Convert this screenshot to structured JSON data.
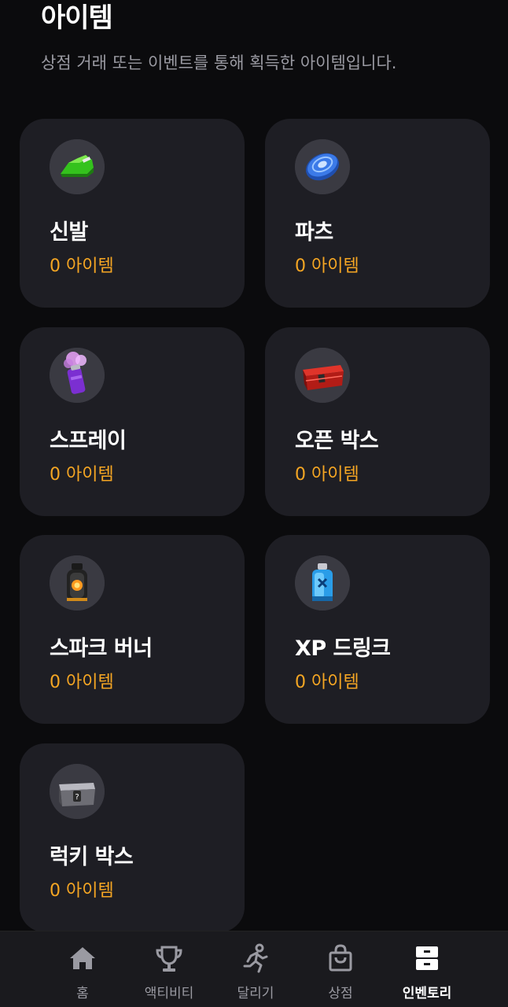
{
  "header": {
    "title": "아이템",
    "subtitle": "상점 거래 또는 이벤트를 통해 획득한 아이템입니다."
  },
  "items": [
    {
      "name": "신발",
      "count": "0 아이템",
      "icon": "sneaker-icon"
    },
    {
      "name": "파츠",
      "count": "0 아이템",
      "icon": "parts-disc-icon"
    },
    {
      "name": "스프레이",
      "count": "0 아이템",
      "icon": "spray-can-icon"
    },
    {
      "name": "오픈 박스",
      "count": "0 아이템",
      "icon": "red-box-icon"
    },
    {
      "name": "스파크 버너",
      "count": "0 아이템",
      "icon": "spark-burner-icon"
    },
    {
      "name": "XP 드링크",
      "count": "0 아이템",
      "icon": "xp-drink-icon"
    },
    {
      "name": "럭키 박스",
      "count": "0 아이템",
      "icon": "lucky-box-icon"
    }
  ],
  "tabbar": {
    "tabs": [
      {
        "label": "홈",
        "icon": "home-icon"
      },
      {
        "label": "액티비티",
        "icon": "trophy-icon"
      },
      {
        "label": "달리기",
        "icon": "runner-icon"
      },
      {
        "label": "상점",
        "icon": "shopping-bag-icon"
      },
      {
        "label": "인벤토리",
        "icon": "inventory-icon"
      }
    ],
    "active": "인벤토리"
  },
  "colors": {
    "background": "#0b0b0d",
    "card": "#1e1e24",
    "accent": "#f5a623",
    "muted": "#9a9aa2"
  }
}
